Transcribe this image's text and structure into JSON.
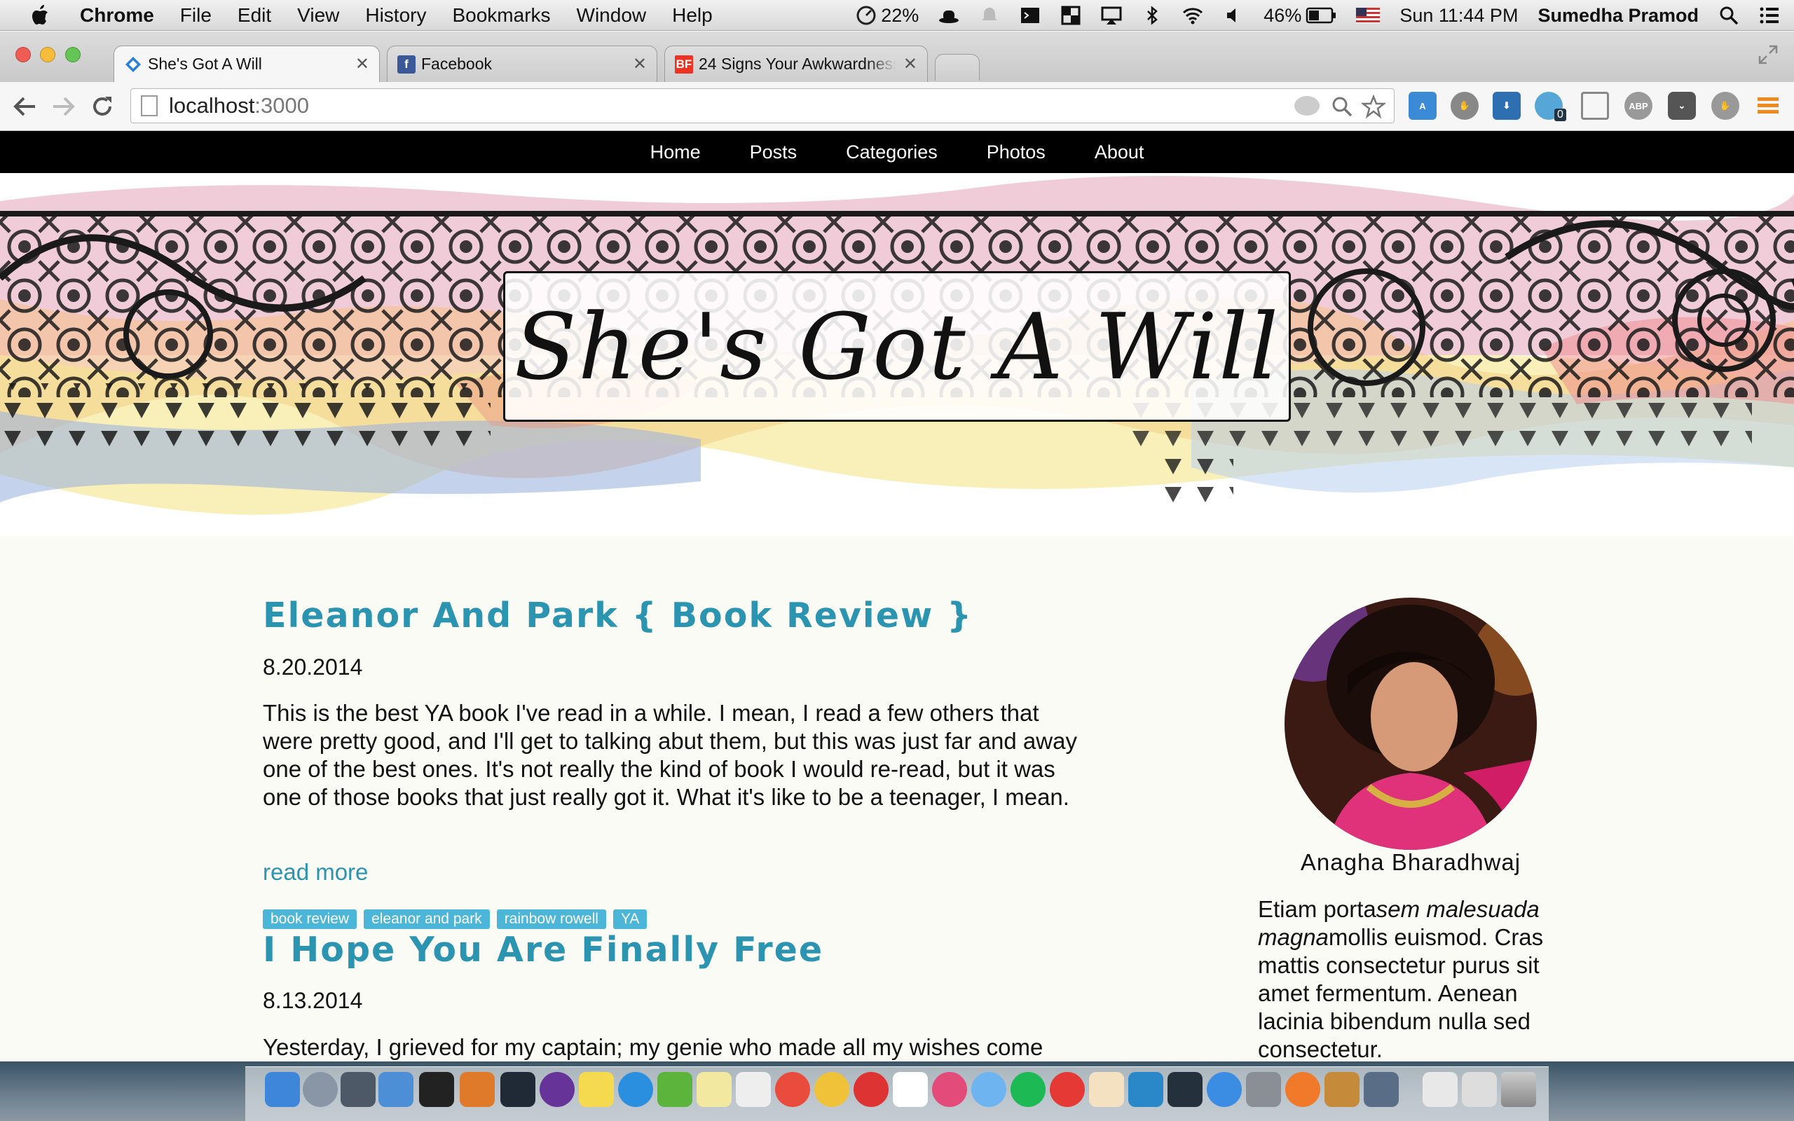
{
  "menubar": {
    "app_name": "Chrome",
    "menus": [
      "File",
      "Edit",
      "View",
      "History",
      "Bookmarks",
      "Window",
      "Help"
    ],
    "status": {
      "cpu_percent": "22%",
      "battery_percent": "46%",
      "clock": "Sun 11:44 PM",
      "user": "Sumedha Pramod"
    }
  },
  "tabs": [
    {
      "title": "She's Got A Will",
      "favicon": "blog-icon",
      "active": true
    },
    {
      "title": "Facebook",
      "favicon": "facebook-icon",
      "active": false
    },
    {
      "title": "24 Signs Your Awkwardness",
      "favicon": "buzzfeed-icon",
      "active": false
    }
  ],
  "toolbar": {
    "url_host": "localhost",
    "url_port": ":3000",
    "extension_badge_count": "0"
  },
  "site": {
    "nav": [
      "Home",
      "Posts",
      "Categories",
      "Photos",
      "About"
    ],
    "blog_title": "She's Got A Will"
  },
  "posts": [
    {
      "title": "Eleanor And Park { Book Review }",
      "date": "8.20.2014",
      "excerpt": "This is the best YA book I've read in a while. I mean, I read a few others that were pretty good, and I'll get to talking abut them, but this was just far and away one of the best ones. It's not really the kind of book I would re-read, but it was one of those books that just really got it. What it's like to be a teenager, I mean.",
      "read_more": "read more",
      "tags": [
        "book review",
        "eleanor and park",
        "rainbow rowell",
        "YA"
      ]
    },
    {
      "title": "I Hope You Are Finally Free",
      "date": "8.13.2014",
      "excerpt": "Yesterday, I grieved for my captain; my genie who made all my wishes come"
    }
  ],
  "sidebar": {
    "author_name": "Anagha Bharadhwaj",
    "bio_part1": "Etiam porta",
    "bio_italic": "sem malesuada magna",
    "bio_part2": "mollis euismod. Cras mattis consectetur purus sit amet fermentum. Aenean lacinia bibendum nulla sed consectetur."
  },
  "colors": {
    "accent": "#2b94b1",
    "tag_bg": "#4cb6d8",
    "nav_bg": "#000000"
  }
}
